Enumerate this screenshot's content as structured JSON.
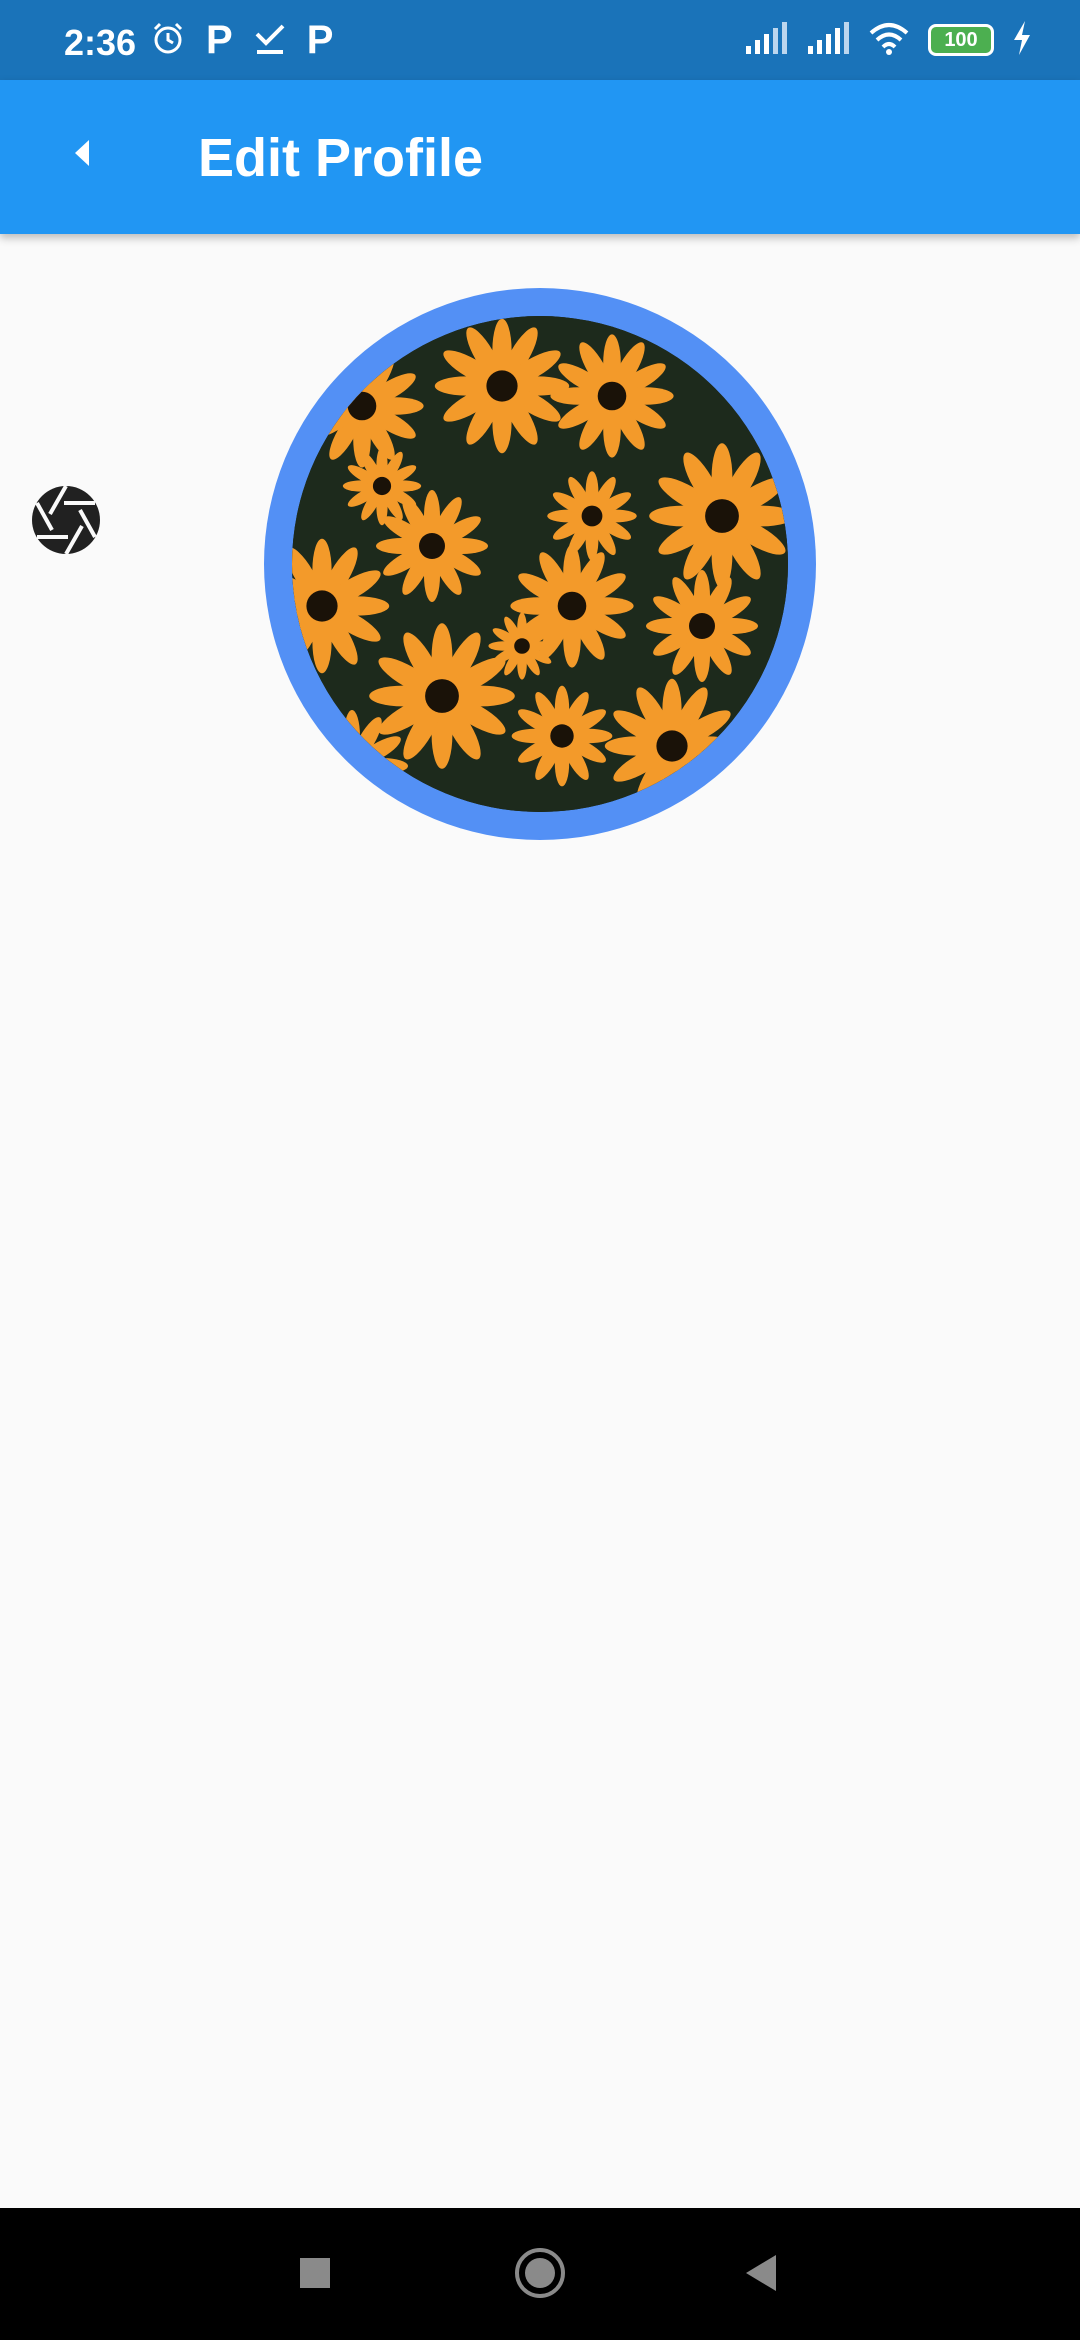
{
  "status_bar": {
    "time": "2:36",
    "left_icons": [
      "alarm-icon",
      "parking-icon",
      "task-check-icon",
      "parking-icon"
    ],
    "p_letter": "P",
    "battery_level": "100",
    "right_icons": [
      "signal-icon",
      "signal-icon",
      "wifi-icon",
      "battery-icon",
      "charging-icon"
    ],
    "color": "#1a73b9"
  },
  "app_bar": {
    "title": "Edit Profile",
    "back_icon": "back-arrow-icon",
    "color": "#2196f3"
  },
  "profile": {
    "camera_icon": "camera-aperture-icon",
    "avatar_ring_color": "#5390f5"
  },
  "nav_bar": {
    "buttons": [
      "recent-apps-icon",
      "home-icon",
      "back-icon"
    ]
  }
}
